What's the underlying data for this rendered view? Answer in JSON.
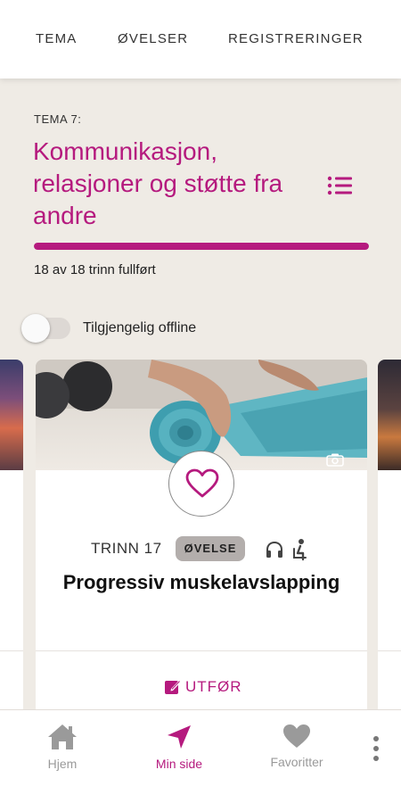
{
  "top_tabs": [
    "TEMA",
    "ØVELSER",
    "REGISTRERINGER"
  ],
  "theme": {
    "number_label": "TEMA 7:",
    "title": "Kommunikasjon, relasjoner og støtte fra andre",
    "progress_fraction": 1.0,
    "progress_text": "18 av 18 trinn fullført"
  },
  "offline": {
    "label": "Tilgjengelig offline",
    "enabled": false
  },
  "card": {
    "step_label": "TRINN 17",
    "badge": "ØVELSE",
    "title": "Progressiv muskelavslapping",
    "action_label": "UTFØR",
    "icons": [
      "heart-icon",
      "headphones-icon",
      "person-icon",
      "camera-icon"
    ]
  },
  "bottom_nav": [
    {
      "label": "Hjem",
      "icon": "home-icon",
      "active": false
    },
    {
      "label": "Min side",
      "icon": "navigation-arrow-icon",
      "active": true
    },
    {
      "label": "Favoritter",
      "icon": "heart-icon",
      "active": false
    }
  ],
  "colors": {
    "accent": "#b51a7e",
    "background": "#efebe5",
    "badge": "#b3aeac",
    "inactive_nav": "#9a9a9a"
  }
}
